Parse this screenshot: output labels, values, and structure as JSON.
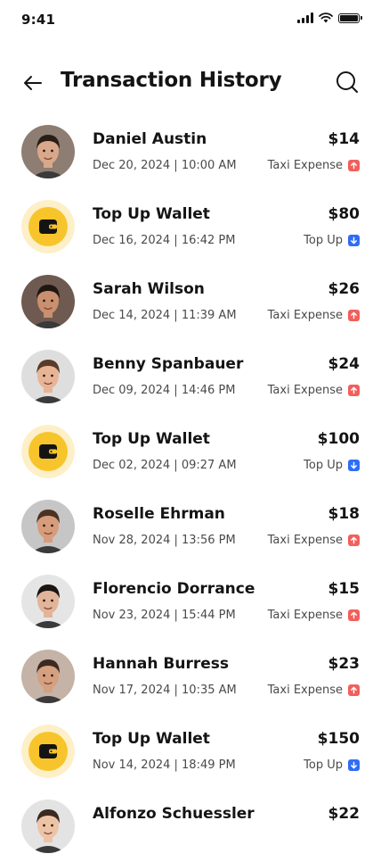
{
  "status_bar": {
    "time": "9:41"
  },
  "header": {
    "title": "Transaction History"
  },
  "colors": {
    "expense_badge": "#f25f5c",
    "topup_badge": "#2f6df6",
    "wallet_yellow": "#f7c52b",
    "wallet_halo": "#fdf0c8"
  },
  "transactions": [
    {
      "name": "Daniel Austin",
      "datetime": "Dec 20, 2024 | 10:00 AM",
      "amount": "$14",
      "type": "Taxi Expense",
      "direction": "up",
      "avatar": "photo"
    },
    {
      "name": "Top Up Wallet",
      "datetime": "Dec 16, 2024 | 16:42 PM",
      "amount": "$80",
      "type": "Top Up",
      "direction": "down",
      "avatar": "wallet-icon"
    },
    {
      "name": "Sarah Wilson",
      "datetime": "Dec 14, 2024 | 11:39 AM",
      "amount": "$26",
      "type": "Taxi Expense",
      "direction": "up",
      "avatar": "photo"
    },
    {
      "name": "Benny Spanbauer",
      "datetime": "Dec 09, 2024 | 14:46 PM",
      "amount": "$24",
      "type": "Taxi Expense",
      "direction": "up",
      "avatar": "photo"
    },
    {
      "name": "Top Up Wallet",
      "datetime": "Dec 02, 2024 | 09:27 AM",
      "amount": "$100",
      "type": "Top Up",
      "direction": "down",
      "avatar": "wallet-icon"
    },
    {
      "name": "Roselle Ehrman",
      "datetime": "Nov 28, 2024 | 13:56 PM",
      "amount": "$18",
      "type": "Taxi Expense",
      "direction": "up",
      "avatar": "photo"
    },
    {
      "name": "Florencio Dorrance",
      "datetime": "Nov 23, 2024 | 15:44 PM",
      "amount": "$15",
      "type": "Taxi Expense",
      "direction": "up",
      "avatar": "photo"
    },
    {
      "name": "Hannah Burress",
      "datetime": "Nov 17, 2024 | 10:35 AM",
      "amount": "$23",
      "type": "Taxi Expense",
      "direction": "up",
      "avatar": "photo"
    },
    {
      "name": "Top Up Wallet",
      "datetime": "Nov 14, 2024 | 18:49 PM",
      "amount": "$150",
      "type": "Top Up",
      "direction": "down",
      "avatar": "wallet-icon"
    },
    {
      "name": "Alfonzo Schuessler",
      "datetime": "",
      "amount": "$22",
      "type": "",
      "direction": "",
      "avatar": "photo"
    }
  ]
}
